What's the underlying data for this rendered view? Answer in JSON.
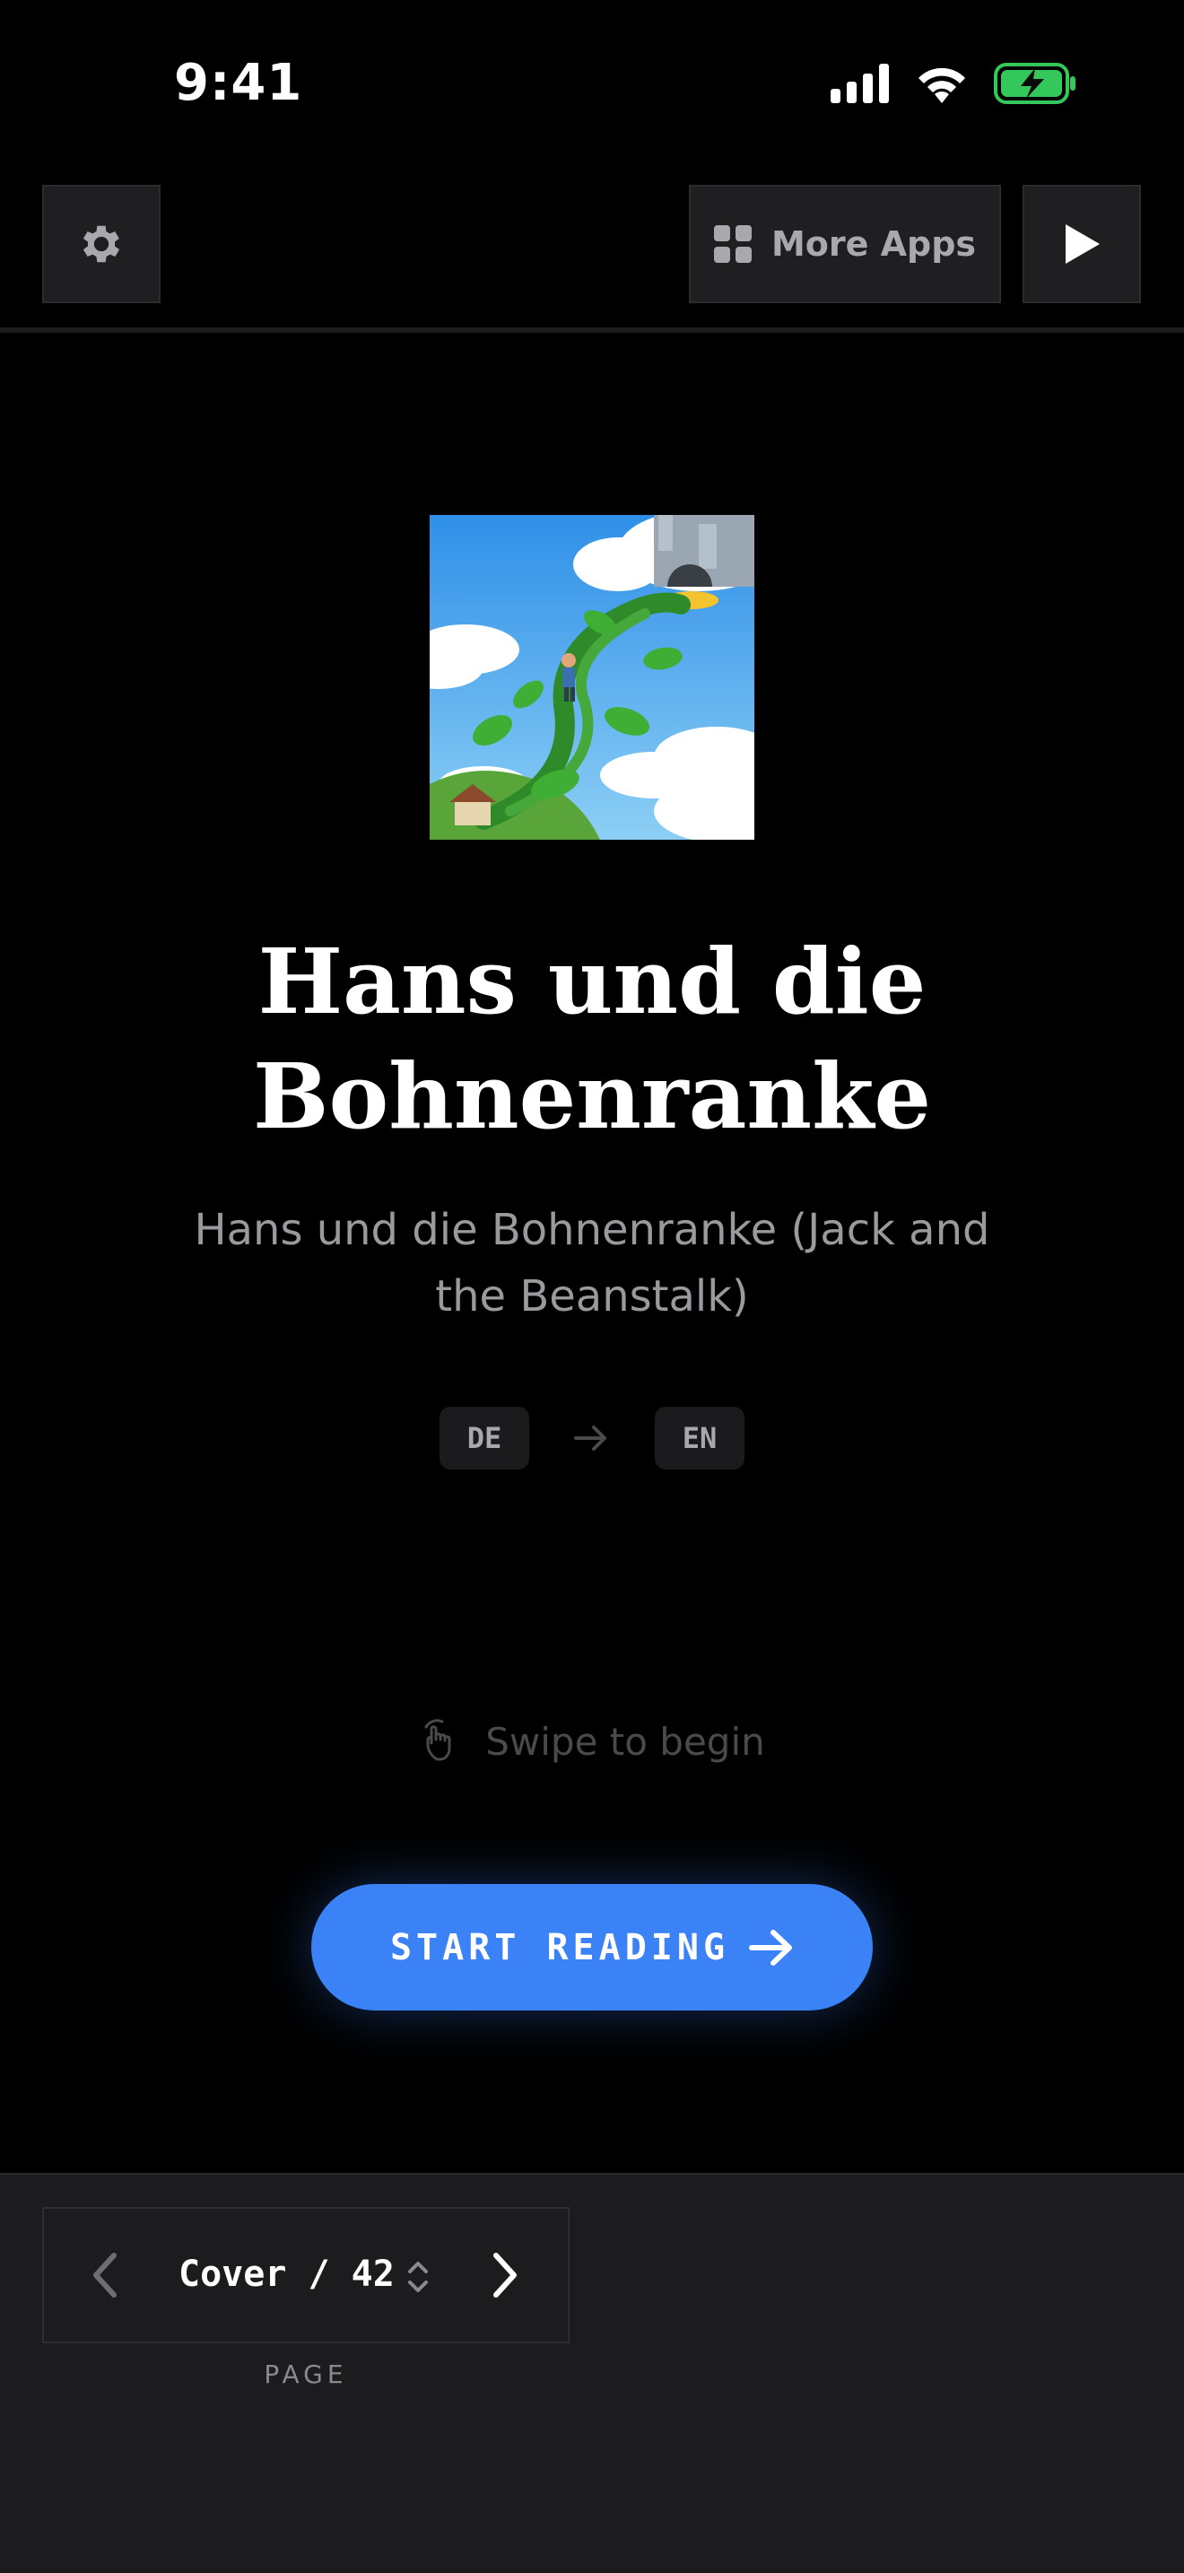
{
  "status_bar": {
    "time": "9:41"
  },
  "toolbar": {
    "more_apps_label": "More Apps"
  },
  "book": {
    "title": "Hans und die Bohnenranke",
    "subtitle": "Hans und die Bohnenranke (Jack and the Beanstalk)",
    "source_lang": "DE",
    "target_lang": "EN"
  },
  "hint": {
    "swipe_label": "Swipe to begin"
  },
  "cta": {
    "start_label": "START READING"
  },
  "pager": {
    "text": "Cover / 42",
    "caption": "PAGE"
  },
  "colors": {
    "accent": "#3b82f6",
    "battery": "#34c759",
    "background": "#000000",
    "panel": "#1c1c1e"
  },
  "icons": [
    "cellular-signal-icon",
    "wifi-icon",
    "battery-charging-icon",
    "gear-icon",
    "grid-icon",
    "play-icon",
    "arrow-right-icon",
    "hand-swipe-icon",
    "chevron-left-icon",
    "chevron-right-icon",
    "chevron-updown-icon"
  ]
}
